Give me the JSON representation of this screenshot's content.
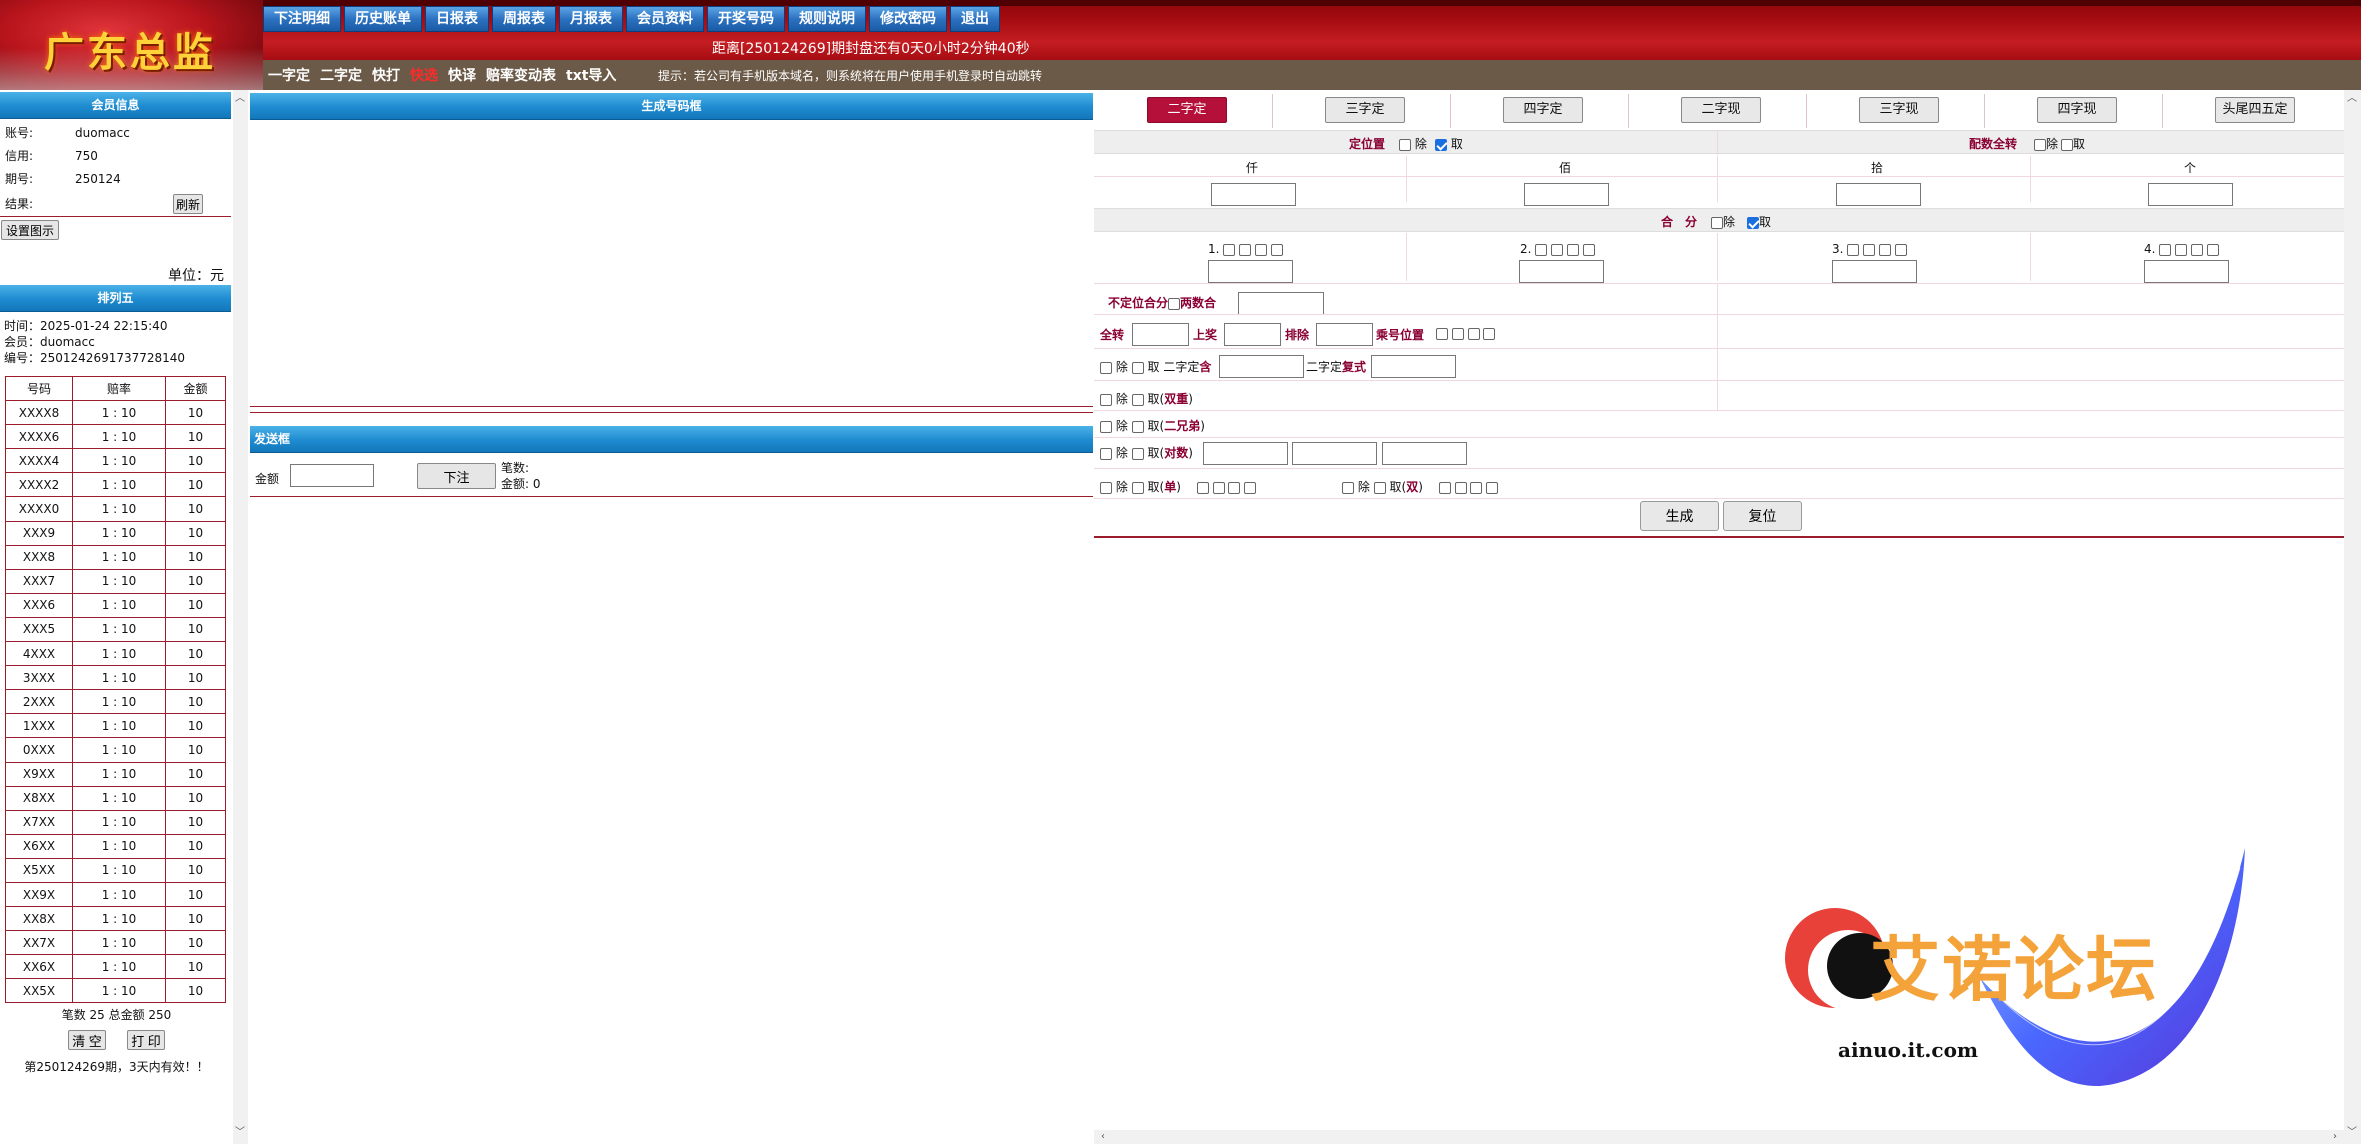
{
  "brand": {
    "logo_text": "广东总监"
  },
  "nav": [
    "下注明细",
    "历史账单",
    "日报表",
    "周报表",
    "月报表",
    "会员资料",
    "开奖号码",
    "规则说明",
    "修改密码",
    "退出"
  ],
  "countdown": "距离[250124269]期封盘还有0天0小时2分钟40秒",
  "subnav": [
    {
      "label": "一字定",
      "active": false
    },
    {
      "label": "二字定",
      "active": false
    },
    {
      "label": "快打",
      "active": false
    },
    {
      "label": "快选",
      "active": true
    },
    {
      "label": "快译",
      "active": false
    },
    {
      "label": "赔率变动表",
      "active": false
    },
    {
      "label": "txt导入",
      "active": false
    }
  ],
  "hint": "提示：若公司有手机版本域名，则系统将在用户使用手机登录时自动跳转",
  "member": {
    "title": "会员信息",
    "account_label": "账号:",
    "account": "duomacc",
    "credit_label": "信用:",
    "credit": "750",
    "period_label": "期号:",
    "period": "250124",
    "result_label": "结果:",
    "refresh": "刷新",
    "settings": "设置图示",
    "unit": "单位：元"
  },
  "p5": {
    "title": "排列五",
    "time": "时间：2025-01-24 22:15:40",
    "member": "会员：duomacc",
    "number": "编号：2501242691737728140",
    "headers": [
      "号码",
      "赔率",
      "金额"
    ],
    "rows": [
      [
        "XXXX8",
        "1 : 10",
        "10"
      ],
      [
        "XXXX6",
        "1 : 10",
        "10"
      ],
      [
        "XXXX4",
        "1 : 10",
        "10"
      ],
      [
        "XXXX2",
        "1 : 10",
        "10"
      ],
      [
        "XXXX0",
        "1 : 10",
        "10"
      ],
      [
        "XXX9",
        "1 : 10",
        "10"
      ],
      [
        "XXX8",
        "1 : 10",
        "10"
      ],
      [
        "XXX7",
        "1 : 10",
        "10"
      ],
      [
        "XXX6",
        "1 : 10",
        "10"
      ],
      [
        "XXX5",
        "1 : 10",
        "10"
      ],
      [
        "4XXX",
        "1 : 10",
        "10"
      ],
      [
        "3XXX",
        "1 : 10",
        "10"
      ],
      [
        "2XXX",
        "1 : 10",
        "10"
      ],
      [
        "1XXX",
        "1 : 10",
        "10"
      ],
      [
        "0XXX",
        "1 : 10",
        "10"
      ],
      [
        "X9XX",
        "1 : 10",
        "10"
      ],
      [
        "X8XX",
        "1 : 10",
        "10"
      ],
      [
        "X7XX",
        "1 : 10",
        "10"
      ],
      [
        "X6XX",
        "1 : 10",
        "10"
      ],
      [
        "X5XX",
        "1 : 10",
        "10"
      ],
      [
        "XX9X",
        "1 : 10",
        "10"
      ],
      [
        "XX8X",
        "1 : 10",
        "10"
      ],
      [
        "XX7X",
        "1 : 10",
        "10"
      ],
      [
        "XX6X",
        "1 : 10",
        "10"
      ],
      [
        "XX5X",
        "1 : 10",
        "10"
      ]
    ],
    "summary": "笔数 25 总金额 250",
    "clear": "清 空",
    "print": "打 印",
    "valid_note": "第250124269期，3天内有效！！"
  },
  "generator": {
    "title": "生成号码框"
  },
  "send": {
    "title": "发送框",
    "amount_label": "金额",
    "place_bet": "下注",
    "count_label": "笔数:",
    "amount_total": "金额: 0"
  },
  "right": {
    "tabs": [
      "二字定",
      "三字定",
      "四字定",
      "二字现",
      "三字现",
      "四字现",
      "头尾四五定"
    ],
    "position_label": "定位置",
    "exclude": "除",
    "take": "取",
    "full_turn_label": "配数全转",
    "columns": [
      "仟",
      "佰",
      "拾",
      "个"
    ],
    "sum_label": "合　分",
    "sum_groups": [
      "1.",
      "2.",
      "3.",
      "4."
    ],
    "unfixed_sum": "不定位合分",
    "two_sum": "两数合",
    "all_turn": "全转",
    "upper": "上奖",
    "exclude_row": "排除",
    "multiply_pos": "乘号位置",
    "two_fixed": "二字定",
    "contains": "含",
    "two_fixed2": "二字定",
    "compound": "复式",
    "double": "双重",
    "two_brothers": "二兄弟",
    "pairs": "对数",
    "odd": "单",
    "even": "双",
    "generate": "生成",
    "reset": "复位"
  },
  "watermark": {
    "title": "艾诺论坛",
    "url": "ainuo.it.com"
  }
}
